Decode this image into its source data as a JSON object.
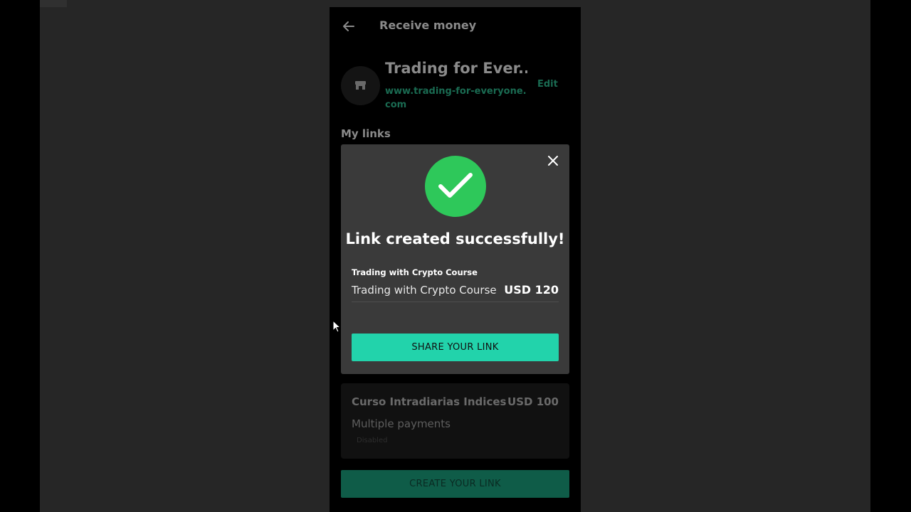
{
  "header": {
    "title": "Receive money"
  },
  "store": {
    "name": "Trading for Ever...",
    "url": "www.trading-for-everyone.com",
    "edit_label": "Edit"
  },
  "links_section": {
    "title": "My links"
  },
  "modal": {
    "title": "Link created successfully!",
    "item_label": "Trading with Crypto Course",
    "item_name": "Trading with Crypto Course",
    "item_price": "USD 120",
    "share_label": "SHARE YOUR LINK"
  },
  "link_card": {
    "title": "Curso Intradiarias Indices",
    "price": "USD 100",
    "subtitle": "Multiple payments",
    "status": "Disabled"
  },
  "create_button": {
    "label": "CREATE YOUR LINK"
  },
  "colors": {
    "accent": "#22d3ab",
    "success": "#2ec85a",
    "modal_bg": "#3a3a3a"
  },
  "icons": [
    "back-arrow-icon",
    "store-icon",
    "close-icon",
    "checkmark-icon",
    "mouse-cursor-icon"
  ]
}
